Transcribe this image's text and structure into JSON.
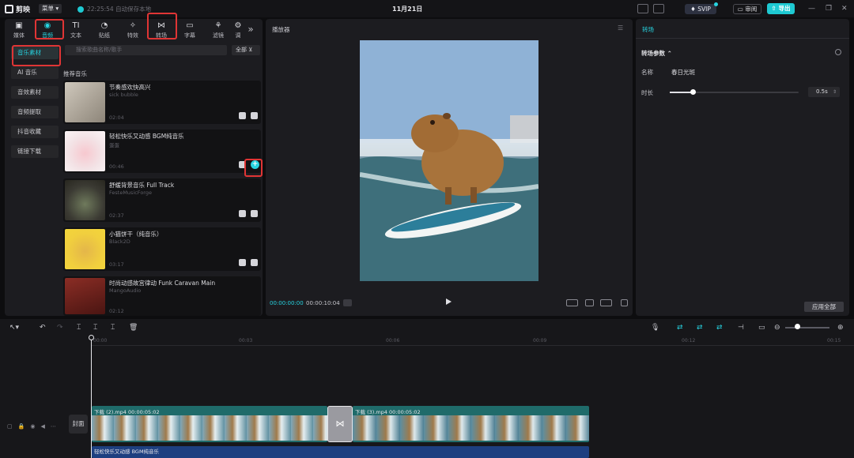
{
  "app": {
    "name": "剪映",
    "menu_label": "菜单",
    "save_status": "22:25:54 自动保存本地",
    "doc_title": "11月21日"
  },
  "topbar": {
    "svip_label": "SVIP",
    "review_label": "审阅",
    "export_label": "导出"
  },
  "tool_tabs": [
    {
      "label": "媒体",
      "icon": "media-icon"
    },
    {
      "label": "音频",
      "icon": "audio-icon",
      "active": true
    },
    {
      "label": "文本",
      "icon": "text-icon"
    },
    {
      "label": "贴纸",
      "icon": "sticker-icon"
    },
    {
      "label": "特效",
      "icon": "effects-icon"
    },
    {
      "label": "转场",
      "icon": "transition-icon"
    },
    {
      "label": "字幕",
      "icon": "subtitle-icon"
    },
    {
      "label": "滤镜",
      "icon": "filter-icon"
    },
    {
      "label": "调",
      "icon": "adjust-icon"
    }
  ],
  "side_nav": [
    "音乐素材",
    "AI 音乐",
    "音效素材",
    "音频提取",
    "抖音收藏",
    "链接下载"
  ],
  "search": {
    "placeholder": "搜索歌曲名称/歌手",
    "filter_label": "全部"
  },
  "section_title": "推荐音乐",
  "music": [
    {
      "title": "节奏感欢快高兴",
      "artist": "sick bubble",
      "duration": "02:04"
    },
    {
      "title": "轻松快乐又动感 BGM纯音乐",
      "artist": "蛋蛋",
      "duration": "00:46"
    },
    {
      "title": "舒缓背景音乐 Full Track",
      "artist": "FesteMusicForge",
      "duration": "02:37"
    },
    {
      "title": "小猫饼干（纯音乐）",
      "artist": "Black2D",
      "duration": "03:17"
    },
    {
      "title": "时尚动感故宫律动 Funk Caravan Main",
      "artist": "MangoAudio",
      "duration": "02:12"
    }
  ],
  "player": {
    "title": "播放器",
    "time_current": "00:00:00:00",
    "time_total": "00:00:10:04"
  },
  "props": {
    "tab": "转场",
    "section": "转场参数",
    "name_label": "名称",
    "name_value": "春日光斑",
    "duration_label": "时长",
    "duration_value": "0.5s",
    "duration_fraction": 0.18,
    "apply_all_label": "应用全部"
  },
  "timeline": {
    "ticks": [
      "00:00",
      "00:03",
      "00:06",
      "00:09",
      "00:12",
      "00:15"
    ],
    "cover_label": "封面",
    "clips": [
      {
        "label": "下载 (2).mp4  00:00:05:02"
      },
      {
        "label": "下载 (3).mp4  00:00:05:02"
      }
    ],
    "audio_label": "轻松快乐又动感 BGM纯音乐",
    "transition_icon": "bowtie-icon"
  },
  "colors": {
    "accent": "#27d3e0",
    "highlight": "#e03535",
    "video_clip": "#1f6b6a",
    "audio_clip": "#1d3f80"
  }
}
